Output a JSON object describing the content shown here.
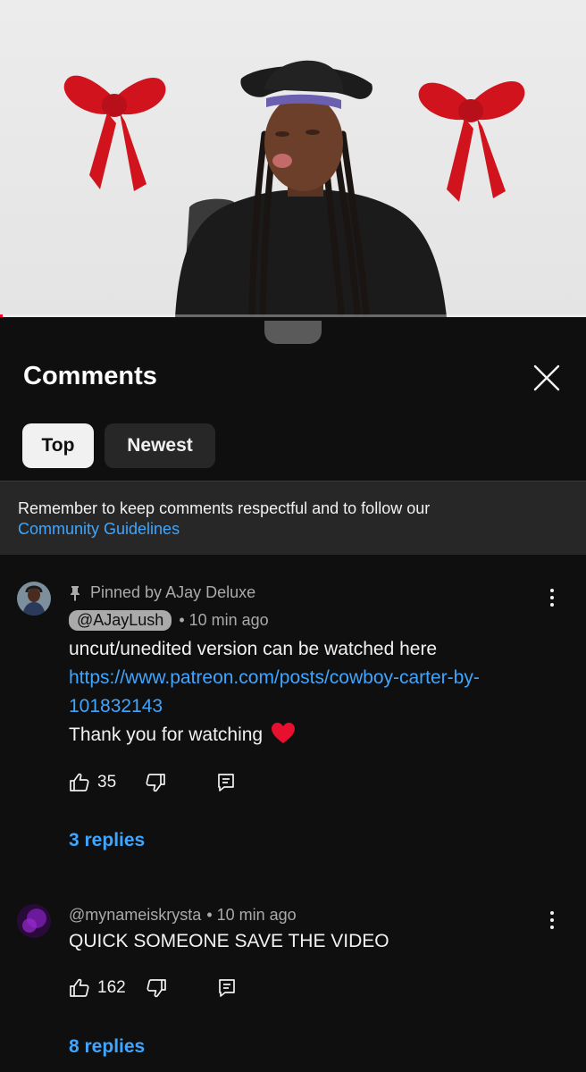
{
  "video": {
    "progress": 0.005,
    "progress_color": "#ff0033"
  },
  "sheet": {
    "title": "Comments",
    "close_icon": "close-icon",
    "filters": {
      "top": "Top",
      "newest": "Newest",
      "selected": "Top"
    },
    "notice": {
      "text": "Remember to keep comments respectful and to follow our",
      "link": "Community Guidelines"
    }
  },
  "comments": [
    {
      "pinned_label": "Pinned by AJay Deluxe",
      "author": "@AJayLush",
      "time": "• 10 min ago",
      "text_line1": "uncut/unedited version can be watched here",
      "link": "https://www.patreon.com/posts/cowboy-carter-by-101832143",
      "text_line2": "Thank you for watching",
      "emoji": "❤️",
      "likes": "35",
      "replies": "3 replies"
    },
    {
      "author": "@mynameiskrysta",
      "time": "• 10 min ago",
      "text": "QUICK SOMEONE SAVE THE VIDEO",
      "likes": "162",
      "replies": "8 replies"
    }
  ],
  "colors": {
    "background": "#0f0f0f",
    "link": "#3ea6ff",
    "chip_selected": "#f1f1f1",
    "chip": "#272727",
    "heart": "#e8102e"
  }
}
